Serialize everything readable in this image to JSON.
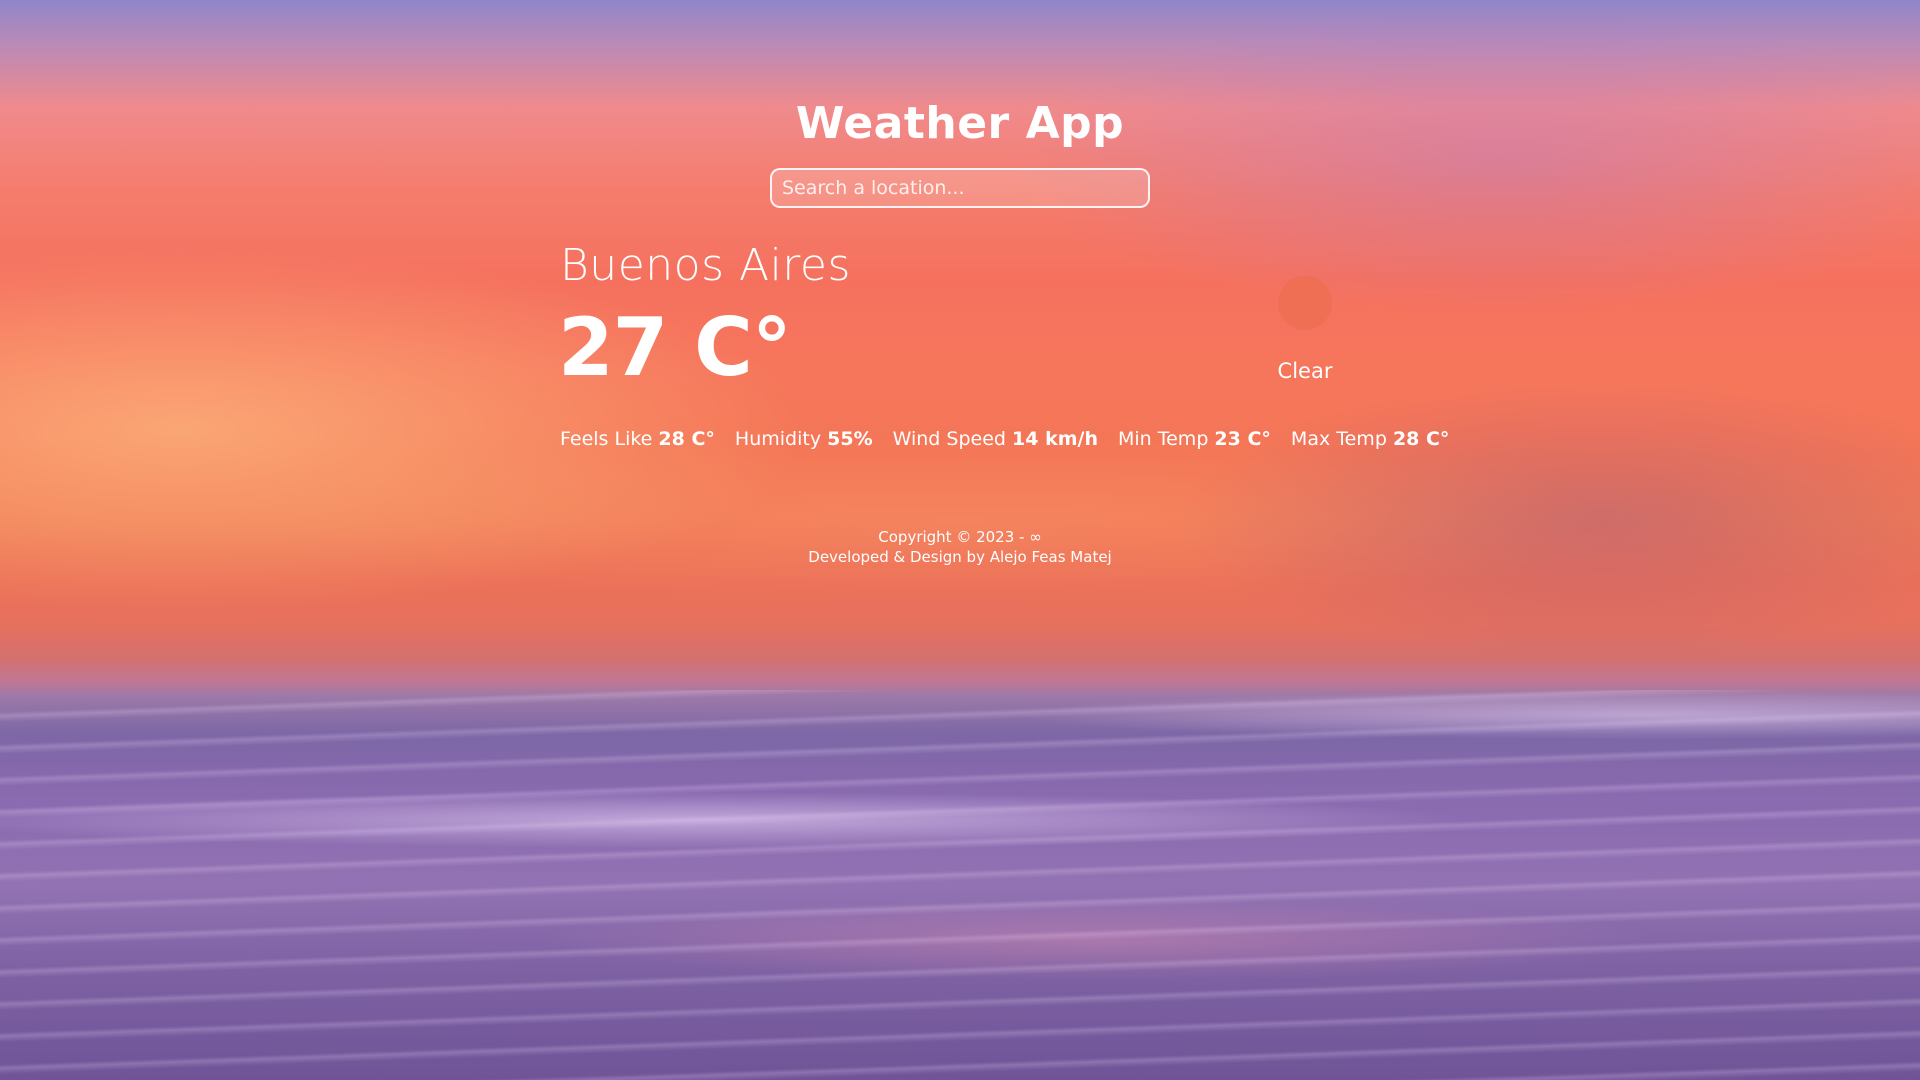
{
  "app": {
    "title": "Weather App"
  },
  "search": {
    "placeholder": "Search a location..."
  },
  "weather": {
    "city": "Buenos Aires",
    "temperature": "27 C°",
    "condition": "Clear",
    "icon": "sun-icon",
    "icon_color": "#ef6f55"
  },
  "stats": {
    "feels_like": {
      "label": "Feels Like",
      "value": "28 C°"
    },
    "humidity": {
      "label": "Humidity",
      "value": "55%"
    },
    "wind_speed": {
      "label": "Wind Speed",
      "value": "14 km/h"
    },
    "min_temp": {
      "label": "Min Temp",
      "value": "23 C°"
    },
    "max_temp": {
      "label": "Max Temp",
      "value": "28 C°"
    }
  },
  "footer": {
    "copyright": "Copyright © 2023 - ∞",
    "credit": "Developed & Design by Alejo Feas Matej"
  }
}
